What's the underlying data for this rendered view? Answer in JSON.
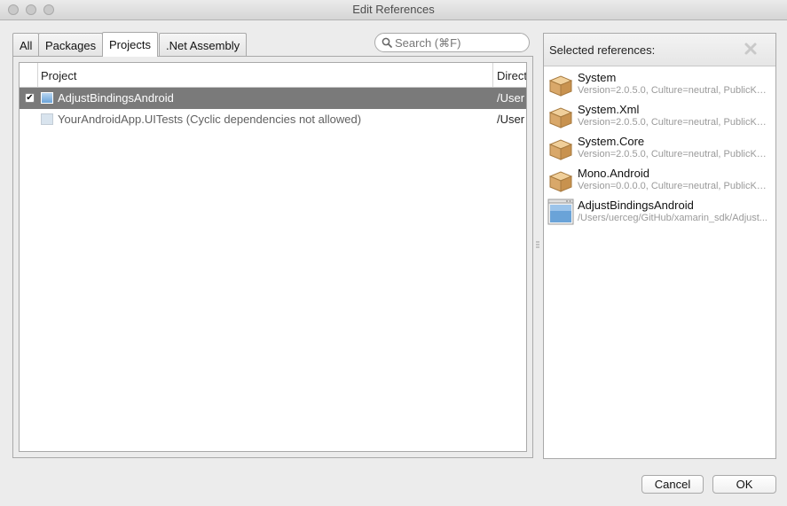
{
  "window": {
    "title": "Edit References"
  },
  "tabs": [
    {
      "label": "All",
      "active": false
    },
    {
      "label": "Packages",
      "active": false
    },
    {
      "label": "Projects",
      "active": true
    },
    {
      "label": ".Net Assembly",
      "active": false
    }
  ],
  "search": {
    "placeholder": "Search (⌘F)",
    "value": ""
  },
  "table": {
    "columns": [
      "Project",
      "Direct"
    ],
    "rows": [
      {
        "checked": true,
        "name": "AdjustBindingsAndroid",
        "directory": "/User",
        "selected": true
      },
      {
        "checked": false,
        "name": "YourAndroidApp.UITests (Cyclic dependencies not allowed)",
        "directory": "/User",
        "selected": false
      }
    ]
  },
  "selected_references": {
    "title": "Selected references:",
    "items": [
      {
        "name": "System",
        "detail": "Version=2.0.5.0, Culture=neutral, PublicKe...",
        "icon": "package-box-icon"
      },
      {
        "name": "System.Xml",
        "detail": "Version=2.0.5.0, Culture=neutral, PublicKe...",
        "icon": "package-box-icon"
      },
      {
        "name": "System.Core",
        "detail": "Version=2.0.5.0, Culture=neutral, PublicKe...",
        "icon": "package-box-icon"
      },
      {
        "name": "Mono.Android",
        "detail": "Version=0.0.0.0, Culture=neutral, PublicKe...",
        "icon": "package-box-icon"
      },
      {
        "name": "AdjustBindingsAndroid",
        "detail": "/Users/uerceg/GitHub/xamarin_sdk/Adjust...",
        "icon": "project-window-icon"
      }
    ]
  },
  "buttons": {
    "cancel": "Cancel",
    "ok": "OK"
  },
  "colors": {
    "selected_row": "#7a7a7a",
    "window_bg": "#ececec",
    "project_icon_blue": "#6aa3d8",
    "package_icon_tan": "#d9a86a"
  }
}
